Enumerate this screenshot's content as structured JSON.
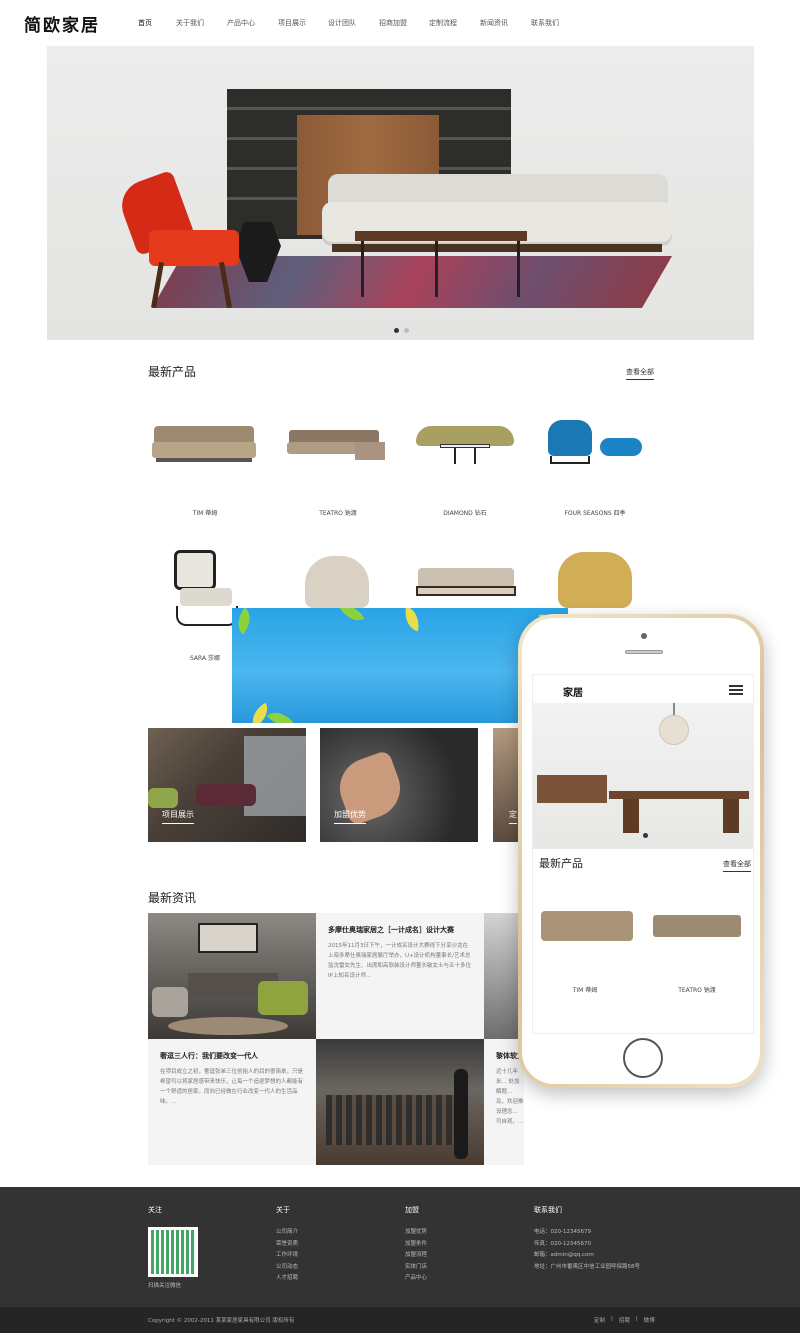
{
  "header": {
    "logo": "简欧家居",
    "nav": [
      "首页",
      "关于我们",
      "产品中心",
      "项目展示",
      "设计团队",
      "招商加盟",
      "定制流程",
      "新闻资讯",
      "联系我们"
    ]
  },
  "products_section": {
    "title": "最新产品",
    "view_all": "查看全部",
    "items": [
      "TIM 蒂姆",
      "TEATRO 钠渡",
      "DIAMOND 钻石",
      "FOUR SEASONS 四季",
      "SARA 莎娜"
    ]
  },
  "features": [
    "项目展示",
    "加盟优势",
    "定"
  ],
  "news_section": {
    "title": "最新资讯",
    "items": [
      {
        "title": "多摩仕奥瑞家居之［一计成名］设计大赛",
        "desc": "2015年11月3日下午，一计成名设计大赛线下分享沙龙在上海多摩仕奥瑞家居展厅举办，U+设计机构董事长/艺术总监沈雷女先生、出席和高软装设计师董长敏女士与五十多位IP上知名设计师..."
      },
      {
        "title": "奢逗三人行：我们要改变一代人",
        "desc": "在项目成立之初，奢逗张弟三位创始人的目的很简单，只是希望可以将家居感带来快乐，让每一个追逐梦想的人都能有一个舒适的居家。而向已经做在行业改变一代人的生活品味。..."
      },
      {
        "title": "黎体软文",
        "desc": "近十几年米... 处加解题... 及，欢迎推设理念... 可自观，..."
      }
    ]
  },
  "phone": {
    "logo": "家居",
    "section_title": "最新产品",
    "view_all": "查看全部",
    "items": [
      "TIM 蒂姆",
      "TEATRO 钠渡"
    ]
  },
  "footer": {
    "follow": {
      "heading": "关注",
      "caption": "扫描关注微信"
    },
    "about": {
      "heading": "关于",
      "links": [
        "公司简介",
        "荣誉资质",
        "工作环境",
        "公司动态",
        "人才招聘"
      ]
    },
    "join": {
      "heading": "加盟",
      "links": [
        "加盟优势",
        "加盟条件",
        "加盟流程",
        "实体门店",
        "产品中心"
      ]
    },
    "contact": {
      "heading": "联系我们",
      "lines": [
        "电话：020-12345679",
        "传真：020-12345670",
        "邮箱：admin@qq.com",
        "地址：广州市番禺区中信工业园呼探路58号"
      ]
    },
    "copyright": "Copyright © 2002-2011 某某家居家具有限公司 版权所有",
    "bottom_links": [
      "定制",
      "|",
      "招聘",
      "|",
      "微博"
    ]
  }
}
